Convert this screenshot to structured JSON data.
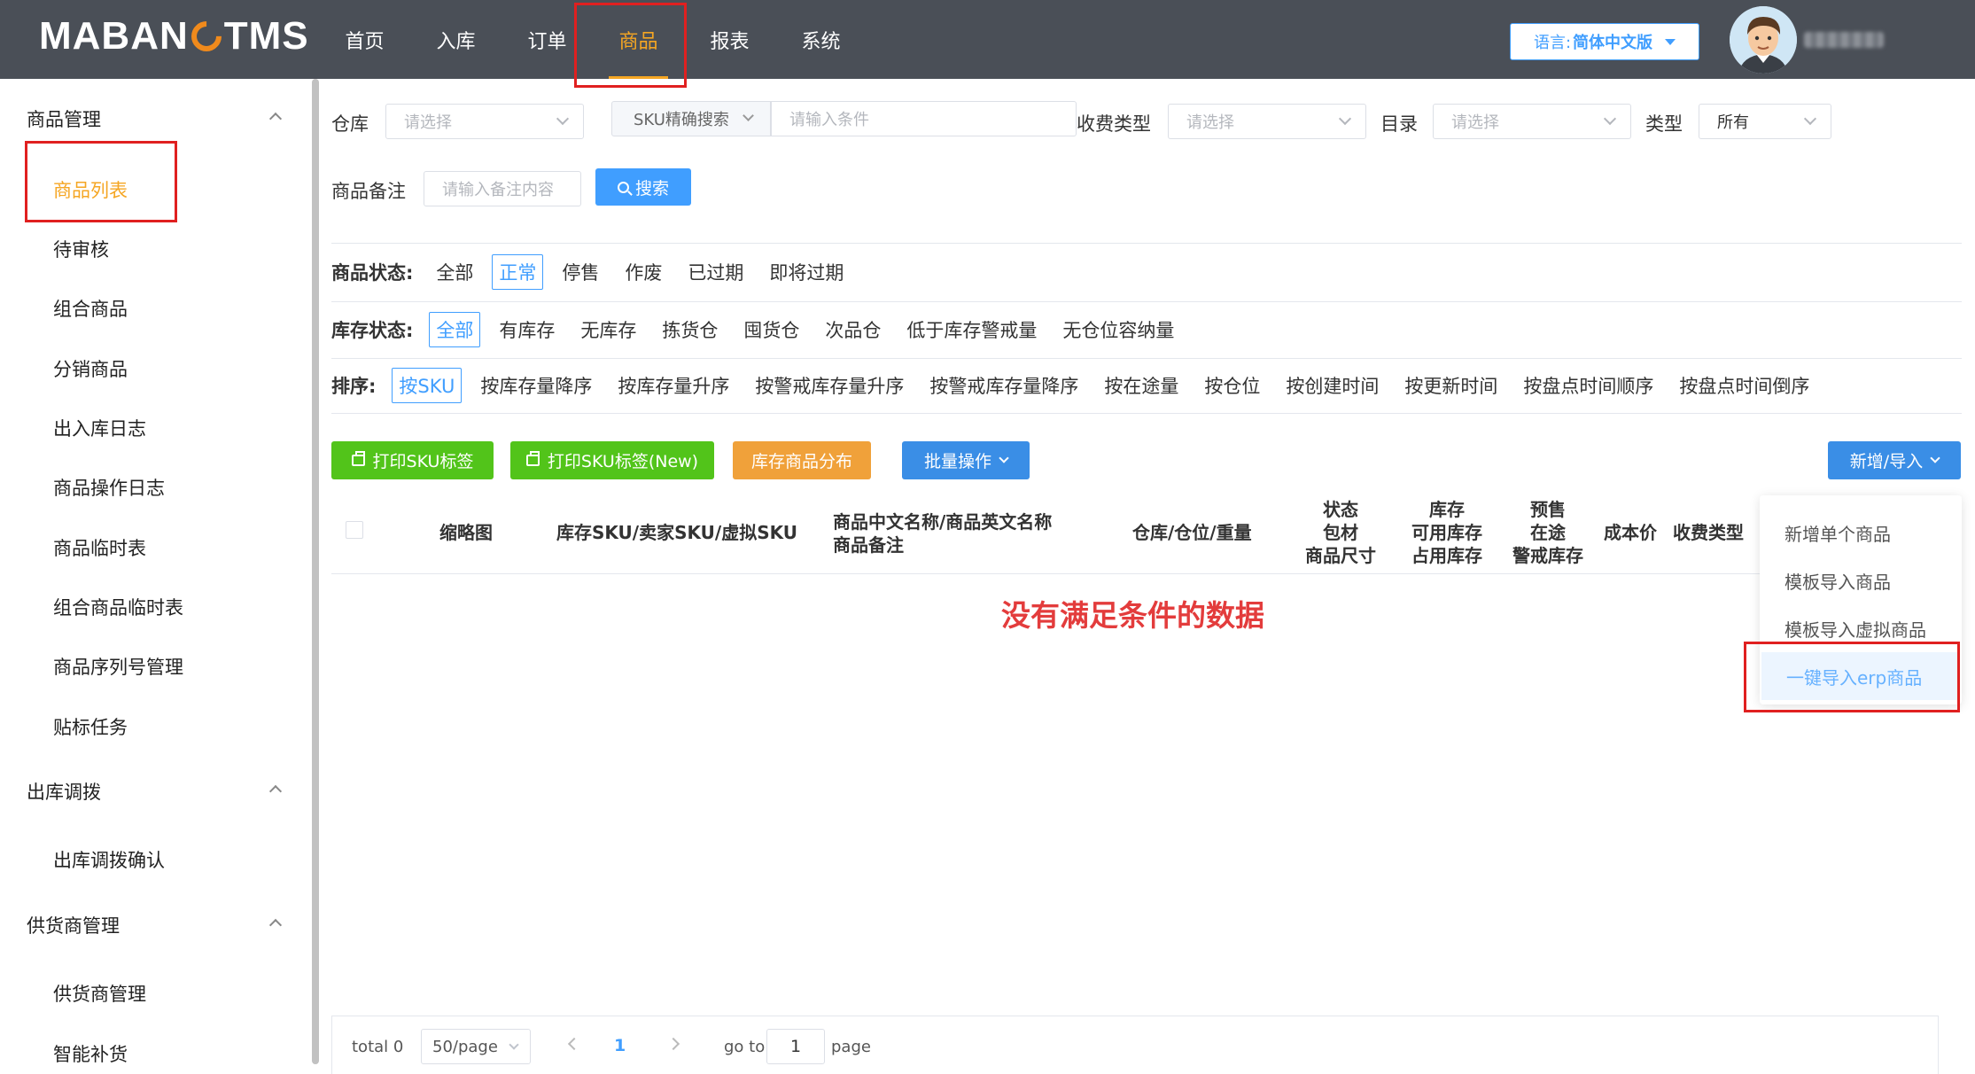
{
  "header": {
    "logo": "MABANGTMS",
    "logo_left": "MABAN",
    "logo_right": "TMS",
    "nav": [
      "首页",
      "入库",
      "订单",
      "商品",
      "报表",
      "系统"
    ],
    "active_nav": "商品",
    "language_label": "语言:",
    "language_value": "简体中文版"
  },
  "sidebar": {
    "groups": [
      {
        "title": "商品管理",
        "items": [
          "商品列表",
          "待审核",
          "组合商品",
          "分销商品",
          "出入库日志",
          "商品操作日志",
          "商品临时表",
          "组合商品临时表",
          "商品序列号管理",
          "贴标任务"
        ]
      },
      {
        "title": "出库调拨",
        "items": [
          "出库调拨确认"
        ]
      },
      {
        "title": "供货商管理",
        "items": [
          "供货商管理",
          "智能补货"
        ]
      }
    ],
    "active_item": "商品列表"
  },
  "filters": {
    "warehouse_label": "仓库",
    "warehouse_placeholder": "请选择",
    "sku_mode": "SKU精确搜索",
    "sku_input_placeholder": "请输入条件",
    "fee_type_label": "收费类型",
    "fee_type_placeholder": "请选择",
    "catalog_label": "目录",
    "catalog_placeholder": "请选择",
    "type_label": "类型",
    "type_value": "所有",
    "remark_label": "商品备注",
    "remark_placeholder": "请输入备注内容",
    "search_button": "搜索"
  },
  "status_filter": {
    "label": "商品状态:",
    "options": [
      "全部",
      "正常",
      "停售",
      "作废",
      "已过期",
      "即将过期"
    ],
    "active": "正常"
  },
  "stock_filter": {
    "label": "库存状态:",
    "options": [
      "全部",
      "有库存",
      "无库存",
      "拣货仓",
      "囤货仓",
      "次品仓",
      "低于库存警戒量",
      "无仓位容纳量"
    ],
    "active": "全部"
  },
  "sort_filter": {
    "label": "排序:",
    "options": [
      "按SKU",
      "按库存量降序",
      "按库存量升序",
      "按警戒库存量升序",
      "按警戒库存量降序",
      "按在途量",
      "按仓位",
      "按创建时间",
      "按更新时间",
      "按盘点时间顺序",
      "按盘点时间倒序"
    ],
    "active": "按SKU"
  },
  "actions": {
    "print_sku": "打印SKU标签",
    "print_sku_new": "打印SKU标签(New)",
    "stock_distribution": "库存商品分布",
    "batch": "批量操作",
    "add_import": "新增/导入"
  },
  "table": {
    "columns": {
      "thumbnail": "缩略图",
      "sku": "库存SKU/卖家SKU/虚拟SKU",
      "name_line1": "商品中文名称/商品英文名称",
      "name_line2": "商品备注",
      "warehouse": "仓库/仓位/重量",
      "status_1": "状态",
      "status_2": "包材",
      "status_3": "商品尺寸",
      "stock_1": "库存",
      "stock_2": "可用库存",
      "stock_3": "占用库存",
      "presale_1": "预售",
      "presale_2": "在途",
      "presale_3": "警戒库存",
      "cost": "成本价",
      "fee_type": "收费类型"
    },
    "empty_message": "没有满足条件的数据"
  },
  "dropdown_menu": {
    "items": [
      "新增单个商品",
      "模板导入商品",
      "模板导入虚拟商品",
      "一键导入erp商品"
    ],
    "hovered": "一键导入erp商品"
  },
  "pagination": {
    "total": "total 0",
    "page_size": "50/page",
    "current_page": "1",
    "goto_label": "go to",
    "goto_value": "1",
    "page_label": "page"
  },
  "colors": {
    "header_bg": "#4a4f57",
    "active": "#f5a623",
    "primary": "#409eff",
    "green": "#52c41a",
    "orange": "#f0a13a",
    "empty_text": "#e33c3c",
    "annotation": "#e02020"
  }
}
